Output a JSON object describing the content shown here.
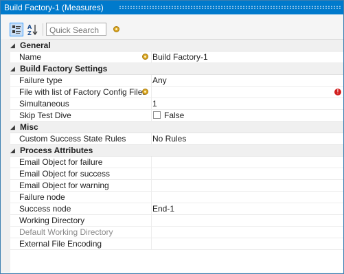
{
  "window": {
    "title": "Build Factory-1 (Measures)"
  },
  "toolbar": {
    "search_placeholder": "Quick Search"
  },
  "sections": {
    "general": {
      "label": "General",
      "toggle": "◢",
      "rows": [
        {
          "name": "Name",
          "value": "Build Factory-1"
        }
      ]
    },
    "build_factory_settings": {
      "label": "Build Factory Settings",
      "toggle": "◢",
      "rows": [
        {
          "name": "Failure type",
          "value": "Any"
        },
        {
          "name": "File with list of Factory Config Files",
          "value": ""
        },
        {
          "name": "Simultaneous",
          "value": "1"
        },
        {
          "name": "Skip Test Dive",
          "value": "False"
        }
      ]
    },
    "misc": {
      "label": "Misc",
      "toggle": "◢",
      "rows": [
        {
          "name": "Custom Success State Rules",
          "value": "No Rules"
        }
      ]
    },
    "process_attributes": {
      "label": "Process Attributes",
      "toggle": "◢",
      "rows": [
        {
          "name": "Email Object for failure",
          "value": ""
        },
        {
          "name": "Email Object for success",
          "value": ""
        },
        {
          "name": "Email Object for warning",
          "value": ""
        },
        {
          "name": "Failure node",
          "value": ""
        },
        {
          "name": "Success node",
          "value": "End-1"
        },
        {
          "name": "Working Directory",
          "value": ""
        },
        {
          "name": "Default Working Directory",
          "value": ""
        },
        {
          "name": "External File Encoding",
          "value": ""
        }
      ]
    }
  },
  "colors": {
    "titlebar": "#007acc",
    "error": "#d21f1f",
    "info": "#d9a520"
  }
}
